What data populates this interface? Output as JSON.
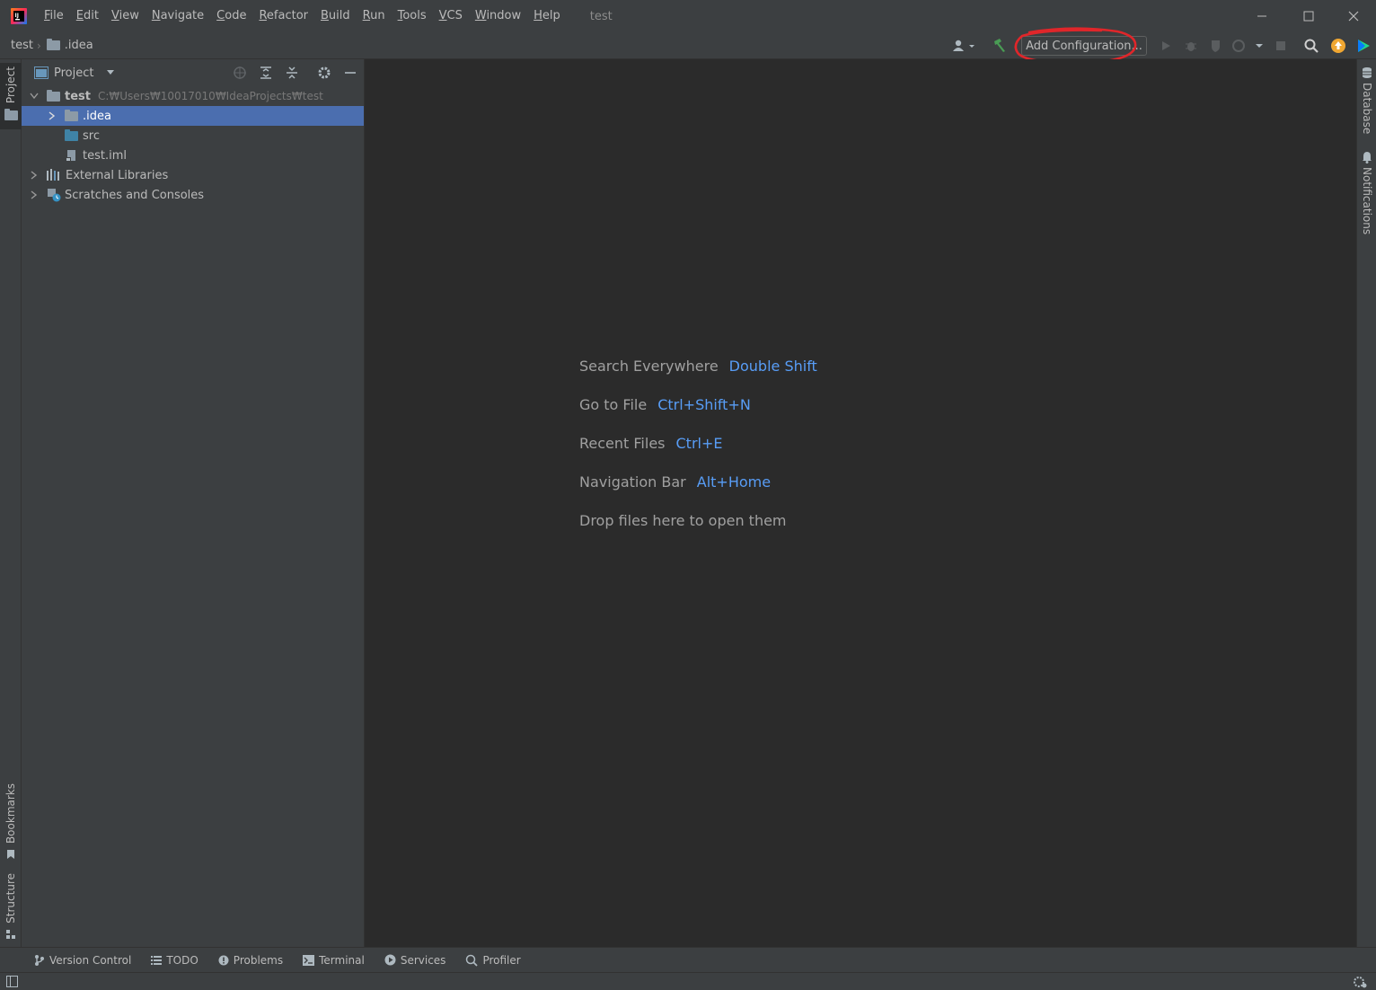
{
  "menu": {
    "items": [
      {
        "label": "File",
        "u": "F",
        "rest": "ile"
      },
      {
        "label": "Edit",
        "u": "E",
        "rest": "dit"
      },
      {
        "label": "View",
        "u": "V",
        "rest": "iew"
      },
      {
        "label": "Navigate",
        "u": "N",
        "rest": "avigate"
      },
      {
        "label": "Code",
        "u": "C",
        "rest": "ode"
      },
      {
        "label": "Refactor",
        "u": "R",
        "rest": "efactor"
      },
      {
        "label": "Build",
        "u": "B",
        "rest": "uild"
      },
      {
        "label": "Run",
        "u": "R",
        "rest": "un"
      },
      {
        "label": "Tools",
        "u": "T",
        "rest": "ools"
      },
      {
        "label": "VCS",
        "u": "V",
        "rest": "CS"
      },
      {
        "label": "Window",
        "u": "W",
        "rest": "indow"
      },
      {
        "label": "Help",
        "u": "H",
        "rest": "elp"
      }
    ],
    "window_title": "test"
  },
  "navbar": {
    "crumb_project": "test",
    "crumb_folder": ".idea",
    "add_configuration": "Add Configuration..."
  },
  "left_stripe": {
    "project": "Project",
    "bookmarks": "Bookmarks",
    "structure": "Structure"
  },
  "right_stripe": {
    "database": "Database",
    "notifications": "Notifications"
  },
  "project_panel": {
    "title": "Project",
    "tree": {
      "root_name": "test",
      "root_path": "C:₩Users₩10017010₩IdeaProjects₩test",
      "idea": ".idea",
      "src": "src",
      "iml": "test.iml",
      "external": "External Libraries",
      "scratches": "Scratches and Consoles"
    }
  },
  "editor": {
    "hints": [
      {
        "label": "Search Everywhere",
        "key": "Double Shift"
      },
      {
        "label": "Go to File",
        "key": "Ctrl+Shift+N"
      },
      {
        "label": "Recent Files",
        "key": "Ctrl+E"
      },
      {
        "label": "Navigation Bar",
        "key": "Alt+Home"
      },
      {
        "label": "Drop files here to open them",
        "key": ""
      }
    ]
  },
  "bottom_bar": {
    "tabs": [
      "Version Control",
      "TODO",
      "Problems",
      "Terminal",
      "Services",
      "Profiler"
    ]
  },
  "colors": {
    "background": "#3c3f41",
    "editor": "#2b2b2b",
    "selection": "#4b6eaf",
    "shortcut": "#589df6",
    "annotation": "#e0262a"
  }
}
